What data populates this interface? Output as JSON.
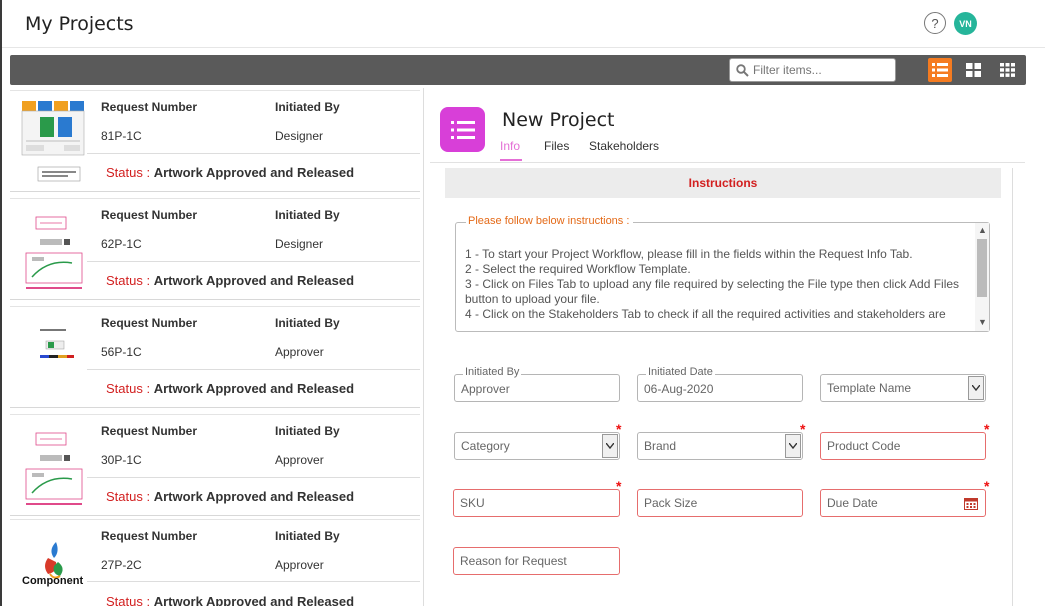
{
  "header": {
    "title": "My Projects",
    "help_label": "?",
    "avatar_initials": "VN",
    "avatar_color": "#26b59a"
  },
  "toolbar": {
    "filter_placeholder": "Filter items...",
    "active_color": "#f57b20",
    "views": [
      "list-view-icon",
      "grid-large-icon",
      "grid-small-icon"
    ]
  },
  "requests": [
    {
      "request_label": "Request Number",
      "initiated_label": "Initiated By",
      "number": "81P-1C",
      "initiated_by": "Designer",
      "status_label": "Status",
      "status": "Artwork Approved and Released"
    },
    {
      "request_label": "Request Number",
      "initiated_label": "Initiated By",
      "number": "62P-1C",
      "initiated_by": "Designer",
      "status_label": "Status",
      "status": "Artwork Approved and Released"
    },
    {
      "request_label": "Request Number",
      "initiated_label": "Initiated By",
      "number": "56P-1C",
      "initiated_by": "Approver",
      "status_label": "Status",
      "status": "Artwork Approved and Released"
    },
    {
      "request_label": "Request Number",
      "initiated_label": "Initiated By",
      "number": "30P-1C",
      "initiated_by": "Approver",
      "status_label": "Status",
      "status": "Artwork Approved and Released"
    },
    {
      "request_label": "Request Number",
      "initiated_label": "Initiated By",
      "number": "27P-2C",
      "initiated_by": "Approver",
      "status_label": "Status",
      "status": "Artwork Approved and Released",
      "thumb_text": "Component"
    }
  ],
  "project": {
    "title": "New Project",
    "icon_color": "#d83fd8",
    "tabs": [
      "Info",
      "Files",
      "Stakeholders"
    ],
    "instructions_title": "Instructions",
    "instructions_legend": "Please follow below instructions :",
    "instructions": [
      "1 - To start your Project Workflow, please fill in the fields within the Request Info Tab.",
      "2 - Select the required Workflow Template.",
      "3 - Click on Files Tab to upload any file required by selecting the File type then click Add Files button to upload your file.",
      "4 - Click on the Stakeholders Tab to check if all the required activities and stakeholders are"
    ],
    "fields": {
      "initiated_by_label": "Initiated By",
      "initiated_by_value": "Approver",
      "initiated_date_label": "Initiated Date",
      "initiated_date_value": "06-Aug-2020",
      "template_placeholder": "Template Name",
      "category_placeholder": "Category",
      "brand_placeholder": "Brand",
      "product_code_placeholder": "Product Code",
      "sku_placeholder": "SKU",
      "pack_size_placeholder": "Pack Size",
      "due_date_placeholder": "Due Date",
      "reason_placeholder": "Reason for Request",
      "required_mark": "*"
    }
  }
}
